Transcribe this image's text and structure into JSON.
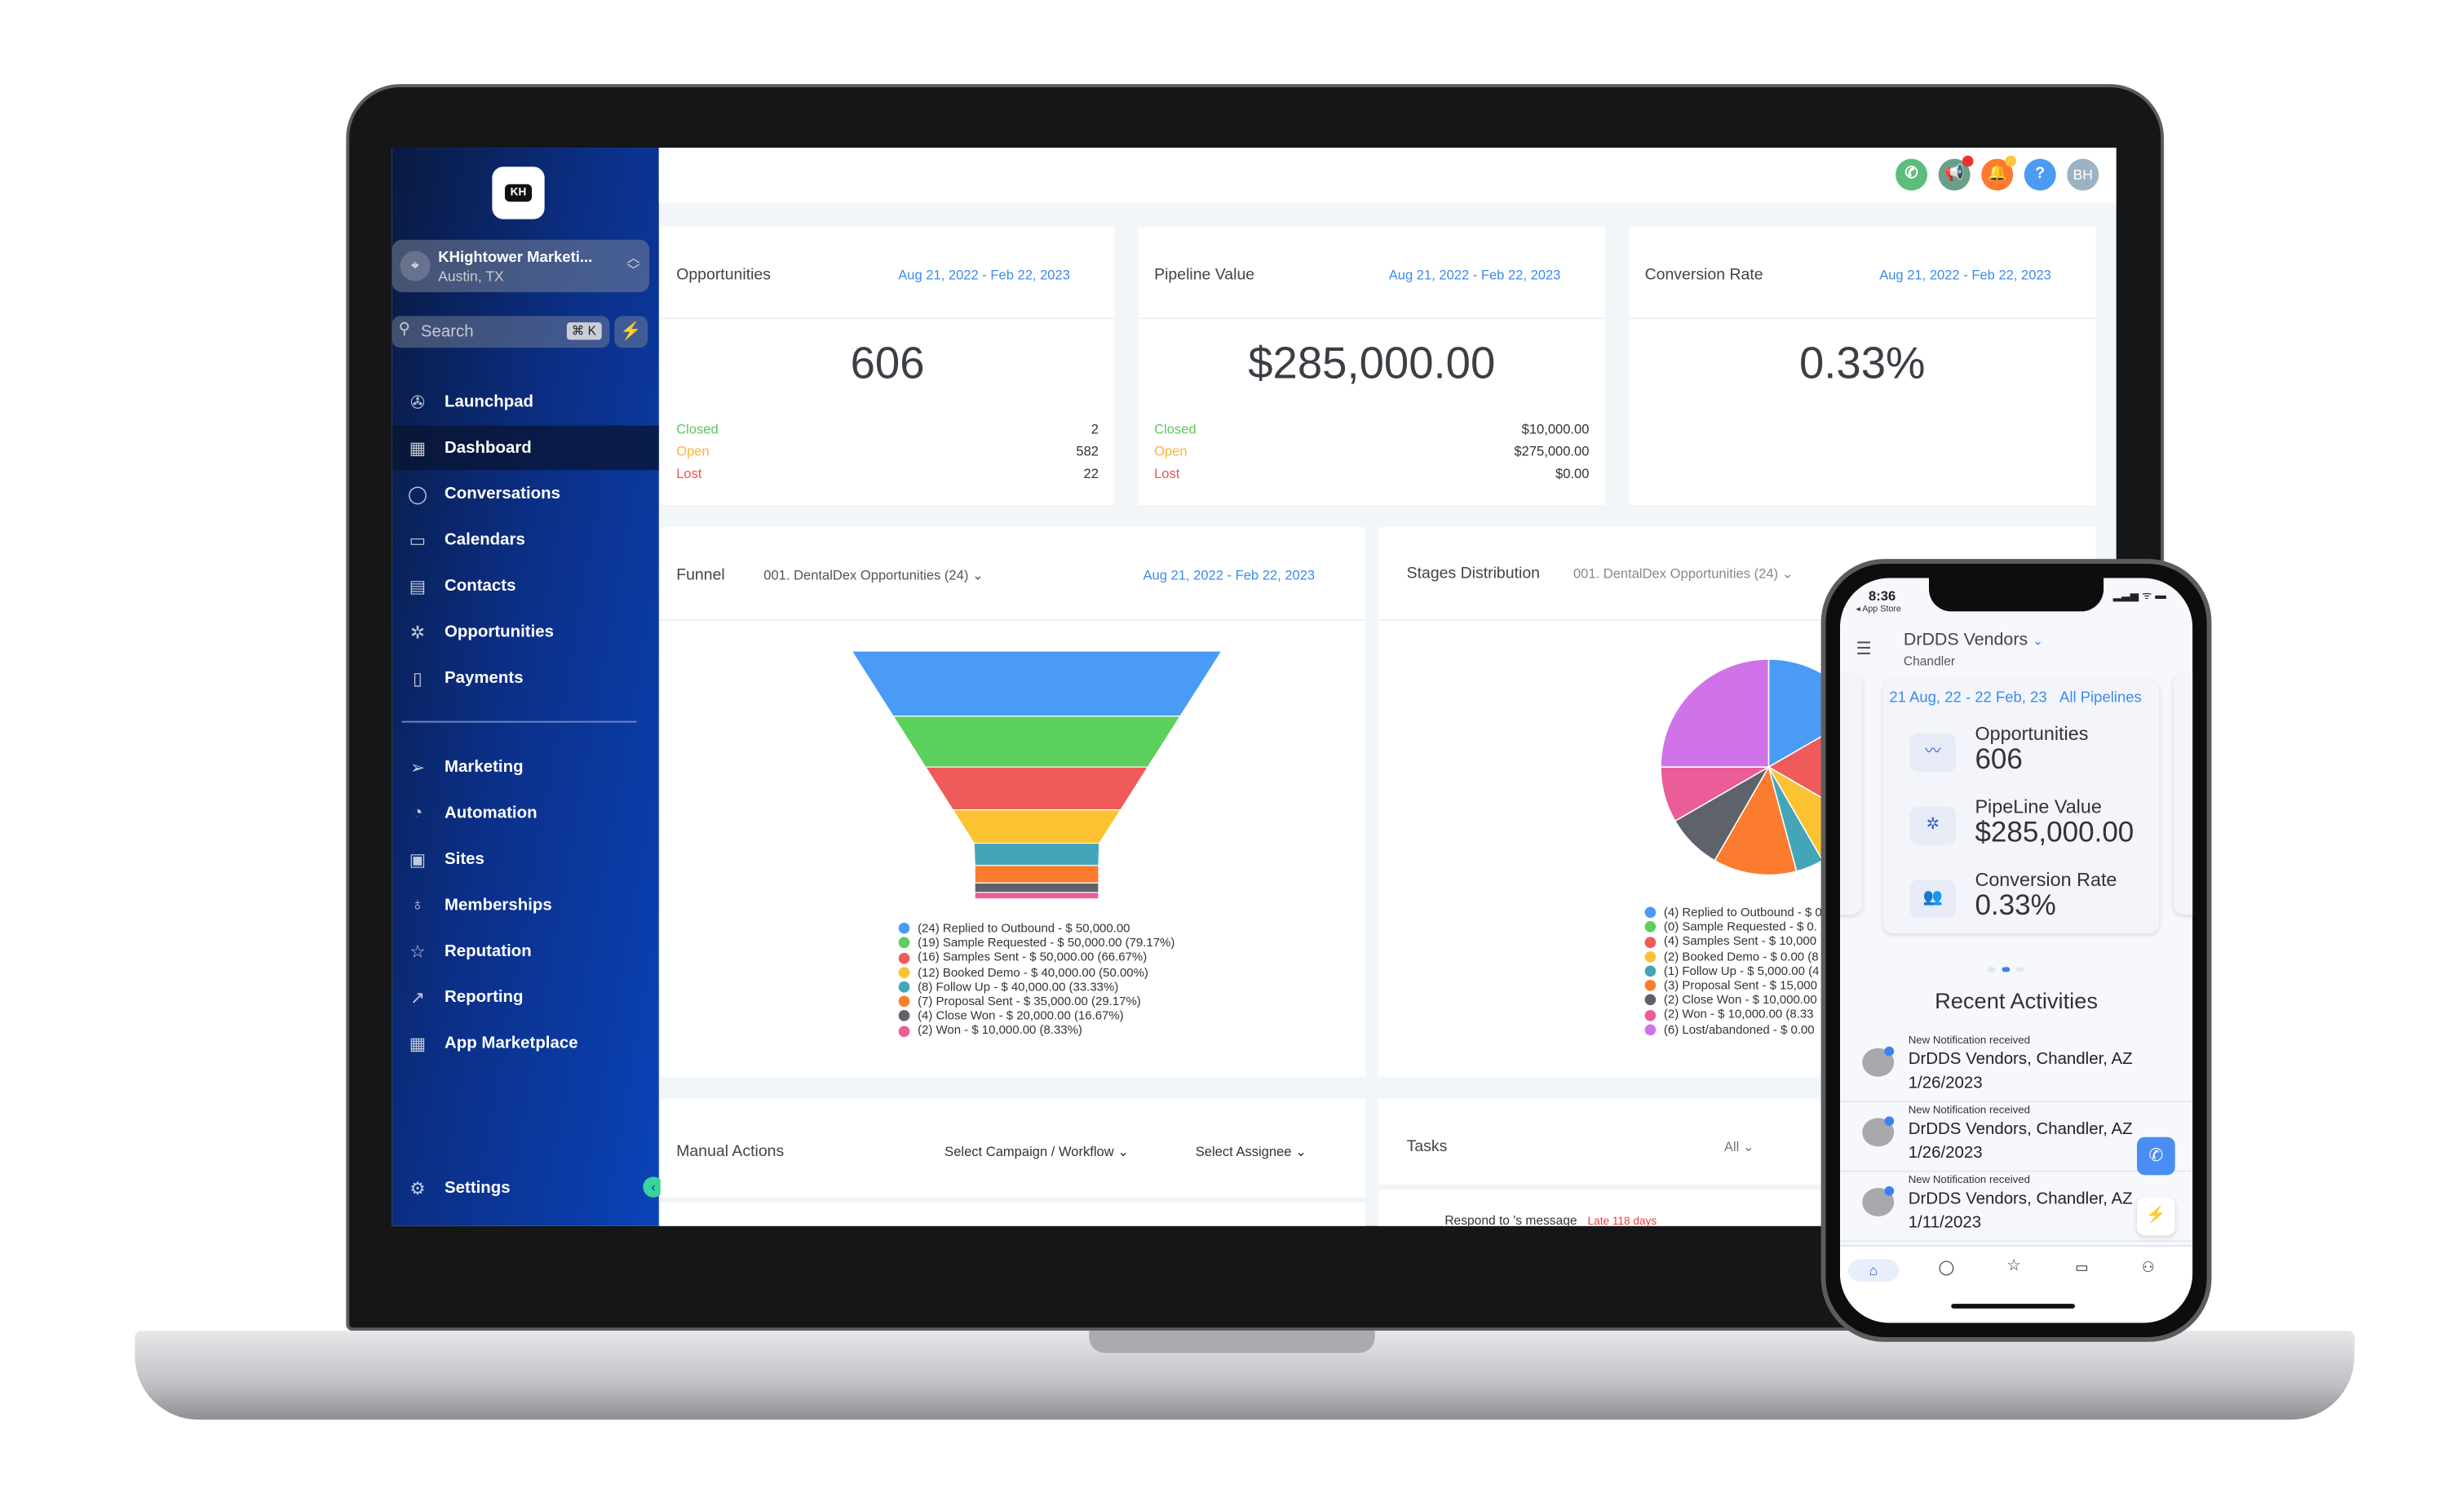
{
  "sidebar": {
    "account": {
      "name": "KHightower Marketi...",
      "location": "Austin, TX"
    },
    "logo_text": "KH",
    "search": {
      "placeholder": "Search",
      "shortcut": "⌘ K"
    },
    "items": [
      {
        "label": "Launchpad",
        "icon": "rocket-icon",
        "glyph": "✇"
      },
      {
        "label": "Dashboard",
        "icon": "dashboard-icon",
        "glyph": "▦",
        "active": true
      },
      {
        "label": "Conversations",
        "icon": "chat-icon",
        "glyph": "◯"
      },
      {
        "label": "Calendars",
        "icon": "calendar-icon",
        "glyph": "▭"
      },
      {
        "label": "Contacts",
        "icon": "contacts-icon",
        "glyph": "▤"
      },
      {
        "label": "Opportunities",
        "icon": "opportunities-icon",
        "glyph": "✲"
      },
      {
        "label": "Payments",
        "icon": "payments-icon",
        "glyph": "▯"
      }
    ],
    "items2": [
      {
        "label": "Marketing",
        "icon": "send-icon",
        "glyph": "➢"
      },
      {
        "label": "Automation",
        "icon": "automation-icon",
        "glyph": "◔"
      },
      {
        "label": "Sites",
        "icon": "sites-icon",
        "glyph": "▣"
      },
      {
        "label": "Memberships",
        "icon": "memberships-icon",
        "glyph": "♁"
      },
      {
        "label": "Reputation",
        "icon": "star-icon",
        "glyph": "☆"
      },
      {
        "label": "Reporting",
        "icon": "chart-line-icon",
        "glyph": "↗"
      },
      {
        "label": "App Marketplace",
        "icon": "grid-icon",
        "glyph": "▦"
      }
    ],
    "settings": {
      "label": "Settings",
      "icon": "gear-icon",
      "glyph": "⚙"
    }
  },
  "topbar": {
    "avatar_initials": "BH",
    "colors": {
      "phone": "#5cbd7c",
      "megaphone": "#6aa08a",
      "bell": "#ff7a2f",
      "help": "#4c9bf2",
      "avatar": "#9bb3c3"
    }
  },
  "cards": [
    {
      "title": "Opportunities",
      "date_range": "Aug 21, 2022 - Feb 22, 2023",
      "value": "606",
      "rows": [
        {
          "label": "Closed",
          "value": "2"
        },
        {
          "label": "Open",
          "value": "582"
        },
        {
          "label": "Lost",
          "value": "22"
        }
      ]
    },
    {
      "title": "Pipeline Value",
      "date_range": "Aug 21, 2022 - Feb 22, 2023",
      "value": "$285,000.00",
      "rows": [
        {
          "label": "Closed",
          "value": "$10,000.00"
        },
        {
          "label": "Open",
          "value": "$275,000.00"
        },
        {
          "label": "Lost",
          "value": "$0.00"
        }
      ]
    },
    {
      "title": "Conversion Rate",
      "date_range": "Aug 21, 2022 - Feb 22, 2023",
      "value": "0.33%"
    }
  ],
  "status_colors": {
    "Closed": "#5cc85c",
    "Open": "#f7b731",
    "Lost": "#ee5253"
  },
  "funnel": {
    "title": "Funnel",
    "pipeline": "001. DentalDex Opportunities (24)",
    "date_range": "Aug 21, 2022 - Feb 22, 2023",
    "legend": [
      "(24) Replied to Outbound - $ 50,000.00",
      "(19) Sample Requested - $ 50,000.00 (79.17%)",
      "(16) Samples Sent - $ 50,000.00 (66.67%)",
      "(12) Booked Demo - $ 40,000.00 (50.00%)",
      "(8) Follow Up - $ 40,000.00 (33.33%)",
      "(7) Proposal Sent - $ 35,000.00 (29.17%)",
      "(4) Close Won - $ 20,000.00 (16.67%)",
      "(2) Won - $ 10,000.00 (8.33%)"
    ],
    "counts": [
      24,
      19,
      16,
      12,
      8,
      7,
      4,
      2
    ],
    "colors": [
      "#4a9bf5",
      "#5cd05c",
      "#ef5a5a",
      "#fdc232",
      "#45a5b8",
      "#fb7b2f",
      "#5e636b",
      "#ea5d98"
    ]
  },
  "stages": {
    "title": "Stages Distribution",
    "pipeline": "001. DentalDex Opportunities (24)",
    "legend": [
      "(4) Replied to Outbound - $ 0",
      "(0) Sample Requested - $ 0.",
      "(4) Samples Sent - $ 10,000",
      "(2) Booked Demo - $ 0.00 (8",
      "(1) Follow Up - $ 5,000.00 (4",
      "(3) Proposal Sent - $ 15,000",
      "(2) Close Won - $ 10,000.00",
      "(2) Won - $ 10,000.00 (8.33",
      "(6) Lost/abandoned - $ 0.00"
    ],
    "counts": [
      4,
      0,
      4,
      2,
      1,
      3,
      2,
      2,
      6
    ],
    "colors": [
      "#4a9bf5",
      "#5cd05c",
      "#ef5a5a",
      "#fdc232",
      "#45a5b8",
      "#fb7b2f",
      "#5e636b",
      "#ea5d98",
      "#d073e8"
    ]
  },
  "manual_actions": {
    "title": "Manual Actions",
    "campaign_select": "Select Campaign / Workflow",
    "assignee_select": "Select Assignee"
  },
  "tasks": {
    "title": "Tasks",
    "filter": "All",
    "item": "Respond to 's message",
    "item_status": "Late 118 days"
  },
  "phone": {
    "time": "8:36",
    "back_label": "◂ App Store",
    "location_name": "DrDDS Vendors",
    "location_city": "Chandler",
    "date_range": "21 Aug, 22 - 22 Feb, 23",
    "pipeline_filter": "All Pipelines",
    "stats": [
      {
        "label": "Opportunities",
        "value": "606",
        "icon": "trend-icon",
        "glyph": "〰"
      },
      {
        "label": "PipeLine Value",
        "value": "$285,000.00",
        "icon": "pipeline-icon",
        "glyph": "✲"
      },
      {
        "label": "Conversion Rate",
        "value": "0.33%",
        "icon": "people-icon",
        "glyph": "👥"
      }
    ],
    "recent_title": "Recent Activities",
    "activities": [
      {
        "type": "New Notification received",
        "name": "DrDDS Vendors, Chandler, AZ",
        "date": "1/26/2023"
      },
      {
        "type": "New Notification received",
        "name": "DrDDS Vendors, Chandler, AZ",
        "date": "1/26/2023"
      },
      {
        "type": "New Notification received",
        "name": "DrDDS Vendors, Chandler, AZ",
        "date": "1/11/2023"
      }
    ],
    "carousel": {
      "pages": 3,
      "active": 2
    }
  }
}
